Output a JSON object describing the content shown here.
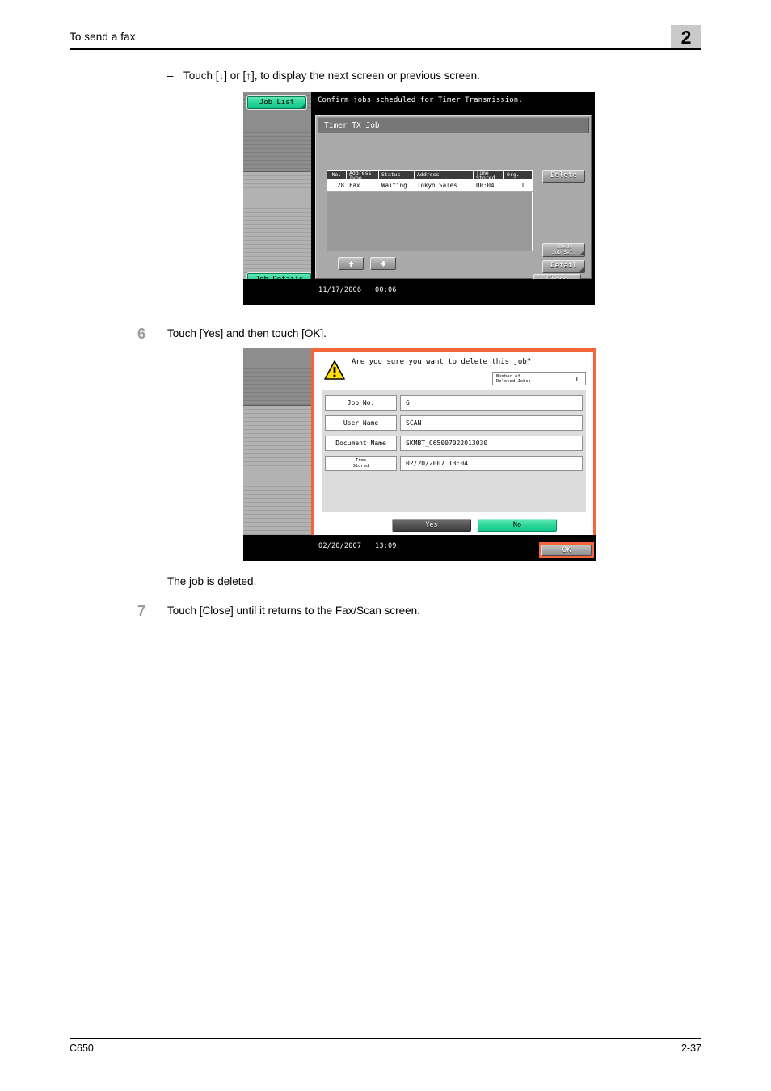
{
  "header": {
    "title": "To send a fax",
    "chapter": "2"
  },
  "body": {
    "dash_mark": "–",
    "dash_text": "Touch [↓] or [↑], to display the next screen or previous screen.",
    "step6_num": "6",
    "step6_text": "Touch [Yes] and then touch [OK].",
    "result_text": "The job is deleted.",
    "step7_num": "7",
    "step7_text": "Touch [Close] until it returns to the Fax/Scan screen."
  },
  "lcd1": {
    "tab_top_label": "Job List",
    "tab_bottom_label": "Job Details",
    "message": "Confirm jobs scheduled for Timer Transmission.",
    "panel_title": "Timer TX Job",
    "table": {
      "headers": [
        "No.",
        "Address\nType",
        "Status",
        "Address",
        "Time\nStored",
        "Org."
      ],
      "headers_flat": [
        "No.",
        "Address Type",
        "Status",
        "Address",
        "Time Stored",
        "Org."
      ],
      "rows": [
        [
          "28",
          "Fax",
          "Waiting",
          "Tokyo Sales",
          "00:04",
          "1"
        ]
      ]
    },
    "buttons": {
      "delete": "Delete",
      "check_job_set_line1": "Check",
      "check_job_set_line2": "Job Set.",
      "detail": "Detail",
      "close": "Close",
      "scroll_up": "↑",
      "scroll_down": "↓"
    },
    "status_date": "11/17/2006",
    "status_time": "00:06"
  },
  "lcd2": {
    "question": "Are you sure you want to delete this job?",
    "deleted_jobs_label_line1": "Number of",
    "deleted_jobs_label_line2": "Deleted Jobs:",
    "deleted_jobs_value": "1",
    "fields": [
      {
        "label": "Job No.",
        "label2": "",
        "value": "6"
      },
      {
        "label": "User Name",
        "label2": "",
        "value": "SCAN"
      },
      {
        "label": "Document Name",
        "label2": "",
        "value": "SKMBT_C65007022013030"
      },
      {
        "label": "Time",
        "label2": "Stored",
        "value": "02/20/2007  13:04"
      }
    ],
    "buttons": {
      "yes": "Yes",
      "no": "No",
      "ok": "OK"
    },
    "status_date": "02/20/2007",
    "status_time": "13:09"
  },
  "footer": {
    "model": "C650",
    "page": "2-37"
  },
  "colors": {
    "accent_green": "#2bd79b",
    "alert_orange": "#f4663a",
    "warning_yellow": "#ffe000",
    "chapter_grey": "#c9c9c9",
    "step_number_grey": "#9b9b9b"
  }
}
